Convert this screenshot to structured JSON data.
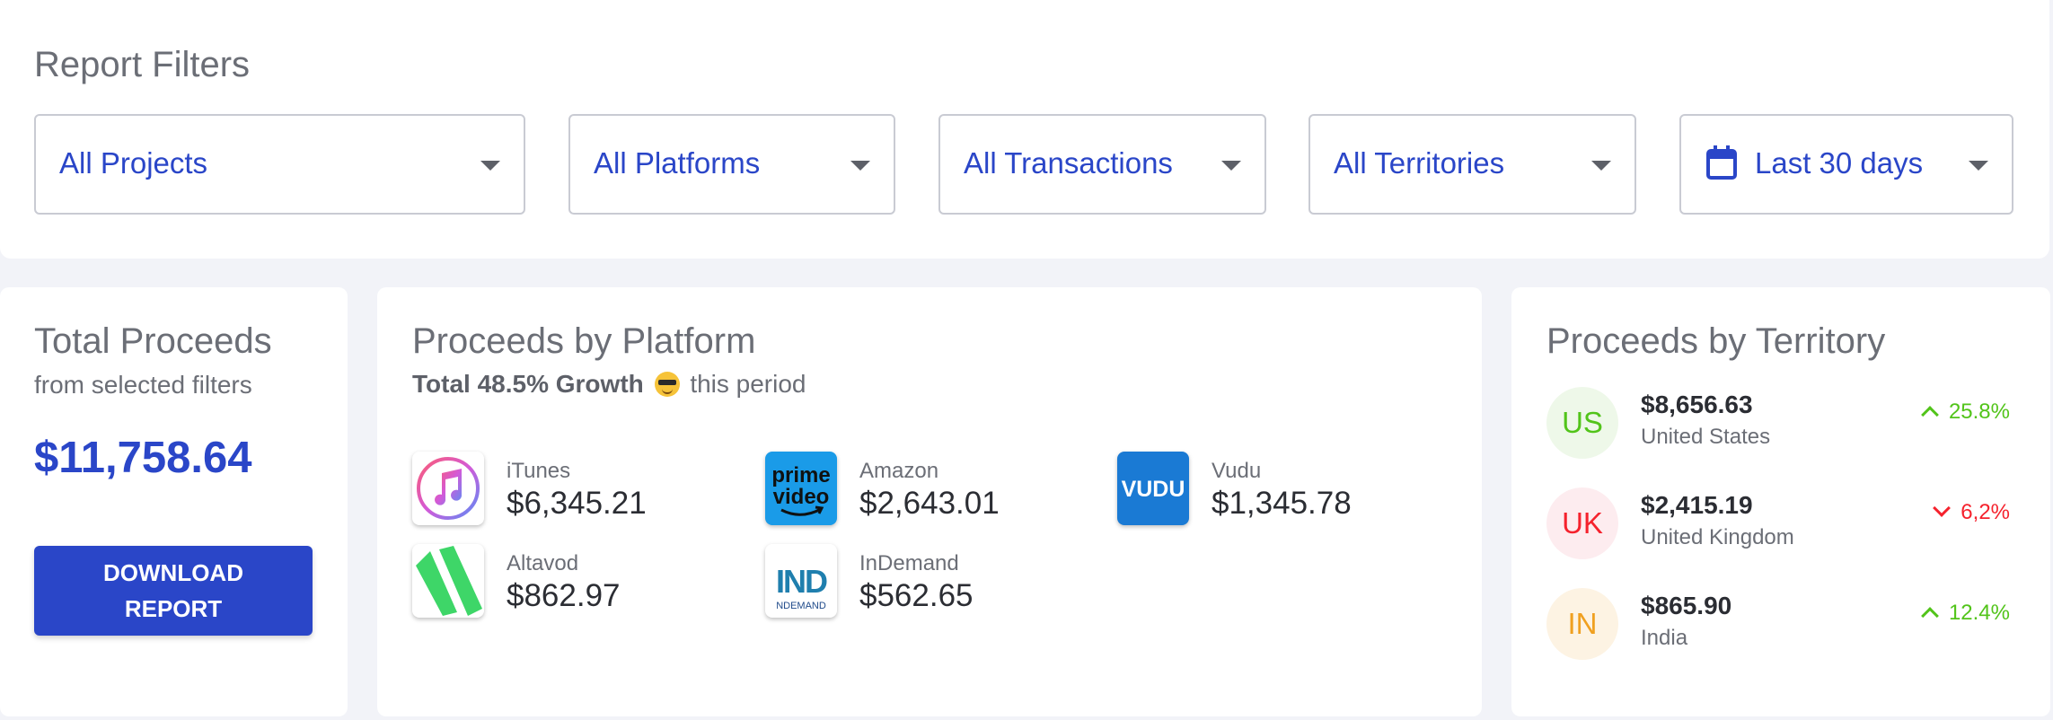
{
  "filters": {
    "title": "Report Filters",
    "projects": "All Projects",
    "platforms": "All Platforms",
    "transactions": "All Transactions",
    "territories": "All Territories",
    "date_range": "Last 30 days"
  },
  "total": {
    "title": "Total Proceeds",
    "subtitle": "from selected filters",
    "amount": "$11,758.64",
    "download_label_line1": "DOWNLOAD",
    "download_label_line2": "REPORT"
  },
  "platforms": {
    "title": "Proceeds by Platform",
    "growth_bold": "Total 48.5% Growth",
    "growth_suffix": "this period",
    "items": [
      {
        "name": "iTunes",
        "amount": "$6,345.21",
        "icon": "itunes-icon"
      },
      {
        "name": "Amazon",
        "amount": "$2,643.01",
        "icon": "prime-video-icon",
        "logo_line1": "prime",
        "logo_line2": "video"
      },
      {
        "name": "Vudu",
        "amount": "$1,345.78",
        "icon": "vudu-icon",
        "logo_text": "VUDU"
      },
      {
        "name": "Altavod",
        "amount": "$862.97",
        "icon": "altavod-icon"
      },
      {
        "name": "InDemand",
        "amount": "$562.65",
        "icon": "indemand-icon",
        "logo_text": "IND",
        "logo_sub": "NDEMAND"
      }
    ]
  },
  "territories": {
    "title": "Proceeds by Territory",
    "items": [
      {
        "code": "US",
        "amount": "$8,656.63",
        "name": "United States",
        "change": "25.8%",
        "direction": "up",
        "color": "#52c41a",
        "badge_bg": "#eef8e9"
      },
      {
        "code": "UK",
        "amount": "$2,415.19",
        "name": "United Kingdom",
        "change": "6,2%",
        "direction": "down",
        "color": "#f5222d",
        "badge_bg": "#fdecef"
      },
      {
        "code": "IN",
        "amount": "$865.90",
        "name": "India",
        "change": "12.4%",
        "direction": "up",
        "color": "#52c41a",
        "badge_bg": "#fdf3e3"
      }
    ]
  },
  "colors": {
    "accent": "#2a46c8",
    "india_badge_text": "#f0a020"
  }
}
